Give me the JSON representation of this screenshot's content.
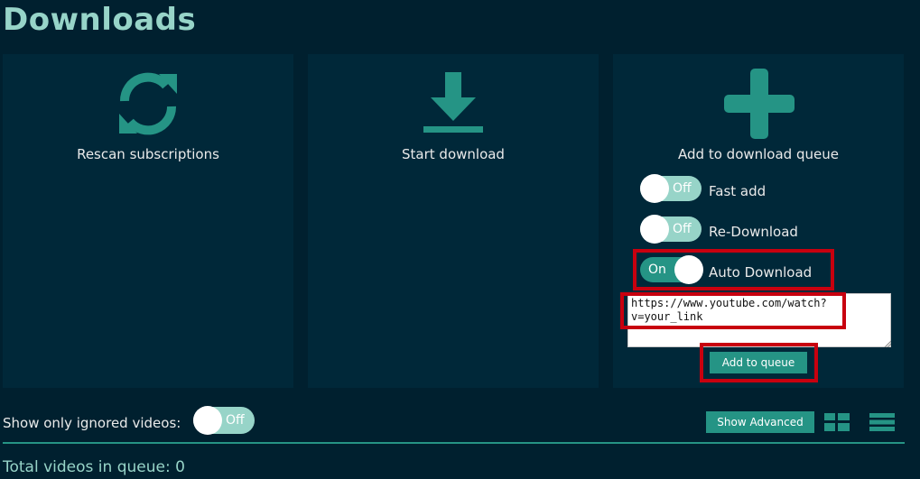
{
  "page": {
    "title": "Downloads"
  },
  "cards": {
    "rescan": {
      "label": "Rescan subscriptions",
      "icon": "refresh-icon"
    },
    "download": {
      "label": "Start download",
      "icon": "download-icon"
    },
    "add": {
      "label": "Add to download queue",
      "icon": "plus-icon"
    }
  },
  "toggles": {
    "fast_add": {
      "label": "Fast add",
      "state": "Off"
    },
    "re_download": {
      "label": "Re-Download",
      "state": "Off"
    },
    "auto_download": {
      "label": "Auto Download",
      "state": "On"
    },
    "ignored_videos": {
      "label": "Show only ignored videos:",
      "state": "Off"
    }
  },
  "queue_form": {
    "url_value": "https://www.youtube.com/watch?v=your_link",
    "submit_label": "Add to queue"
  },
  "toolbar": {
    "show_advanced_label": "Show Advanced",
    "grid_view_icon": "grid-view-icon",
    "list_view_icon": "list-view-icon"
  },
  "status": {
    "total_label": "Total videos in queue: 0"
  },
  "colors": {
    "background": "#00202f",
    "card": "#002839",
    "accent": "#259485",
    "accent_light": "#97d4c8",
    "highlight": "#c8000f"
  }
}
